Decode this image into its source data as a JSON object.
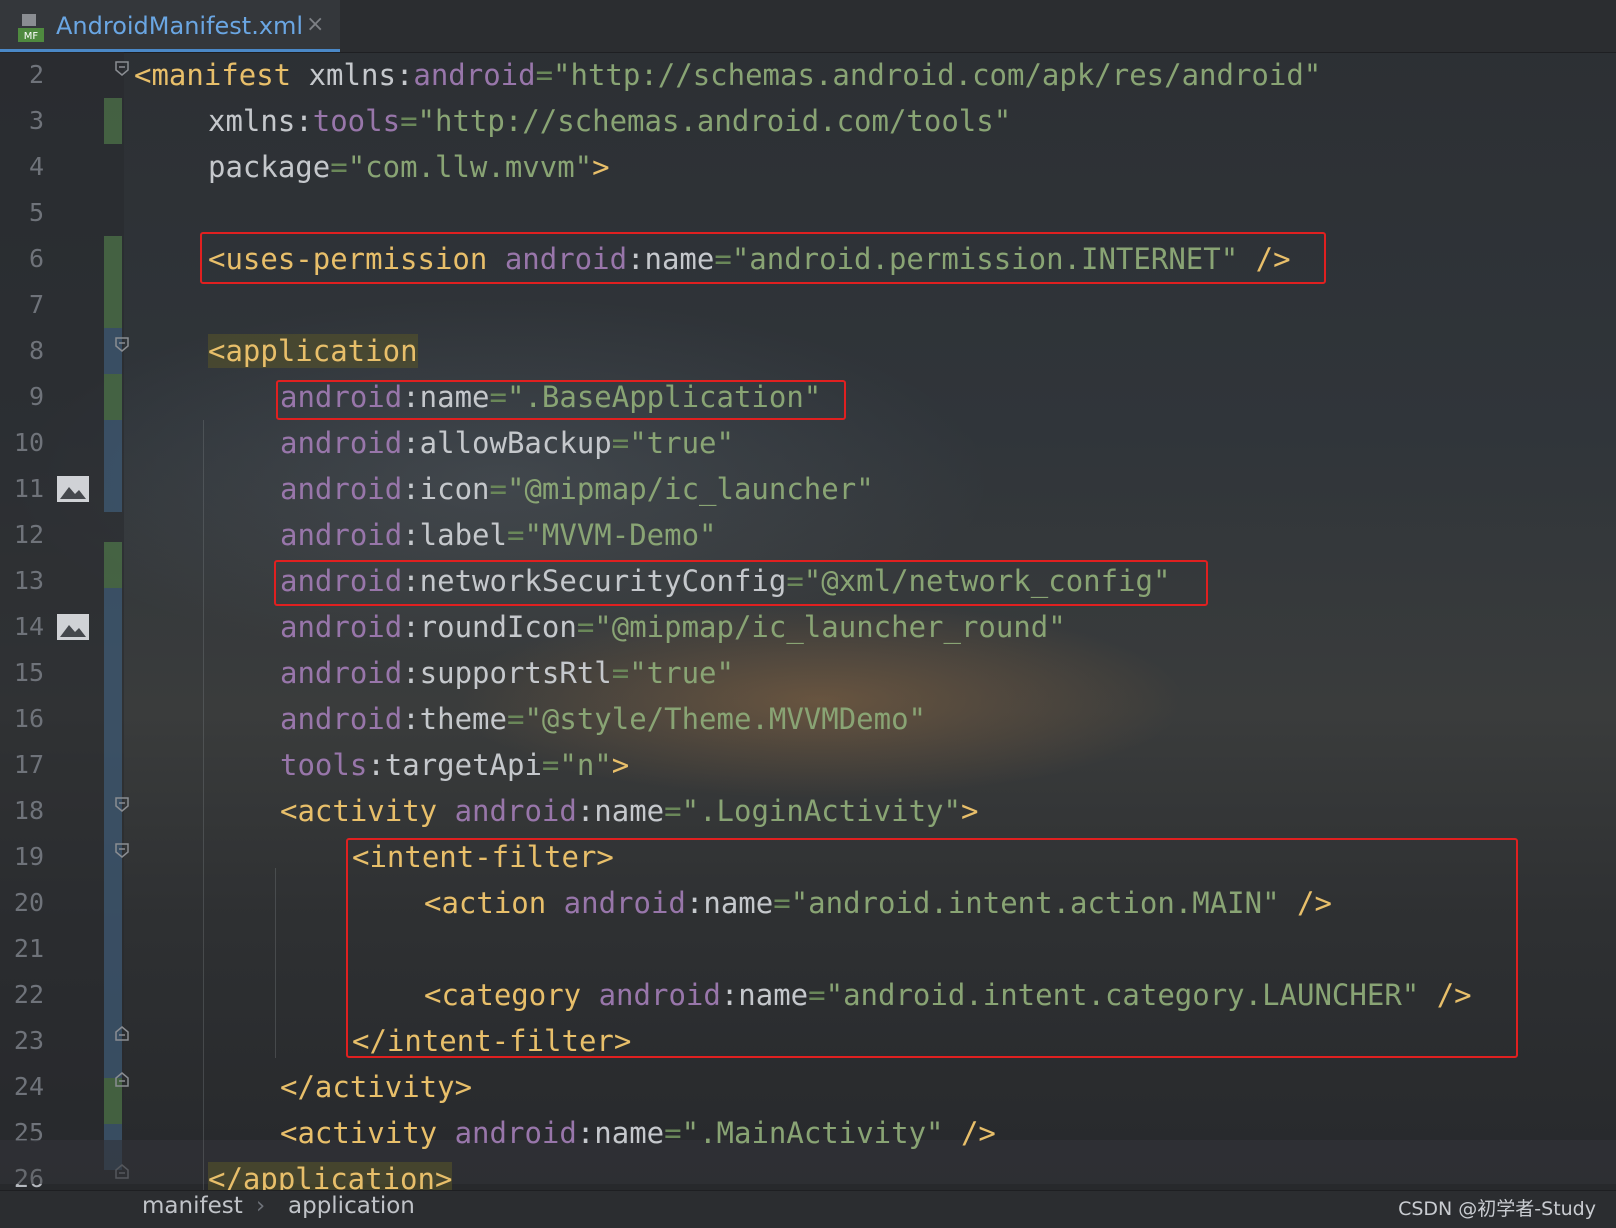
{
  "tab": {
    "title": "AndroidManifest.xml",
    "icon_badge": "MF",
    "close_glyph": "×"
  },
  "line_numbers": [
    "2",
    "3",
    "4",
    "5",
    "6",
    "7",
    "8",
    "9",
    "10",
    "11",
    "12",
    "13",
    "14",
    "15",
    "16",
    "17",
    "18",
    "19",
    "20",
    "21",
    "22",
    "23",
    "24",
    "25",
    "26"
  ],
  "code": {
    "l2": {
      "a": "<manifest",
      "b": " xmlns:",
      "c": "android",
      "d": "=",
      "e": "\"http://schemas.android.com/apk/res/android\""
    },
    "l3": {
      "a": "xmlns:",
      "b": "tools",
      "c": "=",
      "d": "\"http://schemas.android.com/tools\""
    },
    "l4": {
      "a": "package",
      "b": "=",
      "c": "\"com.llw.mvvm\"",
      "d": ">"
    },
    "l6": {
      "a": "<uses-permission",
      "b": " android",
      "c": ":name",
      "d": "=",
      "e": "\"android.permission.INTERNET\"",
      "f": " />"
    },
    "l8": {
      "a": "<",
      "b": "application"
    },
    "l9": {
      "a": "android",
      "b": ":name",
      "c": "=",
      "d": "\".BaseApplication\""
    },
    "l10": {
      "a": "android",
      "b": ":allowBackup",
      "c": "=",
      "d": "\"true\""
    },
    "l11": {
      "a": "android",
      "b": ":icon",
      "c": "=",
      "d": "\"@mipmap/ic_launcher\""
    },
    "l12": {
      "a": "android",
      "b": ":label",
      "c": "=",
      "d": "\"MVVM-Demo\""
    },
    "l13": {
      "a": "android",
      "b": ":networkSecurityConfig",
      "c": "=",
      "d": "\"@xml/network_config\""
    },
    "l14": {
      "a": "android",
      "b": ":roundIcon",
      "c": "=",
      "d": "\"@mipmap/ic_launcher_round\""
    },
    "l15": {
      "a": "android",
      "b": ":supportsRtl",
      "c": "=",
      "d": "\"true\""
    },
    "l16": {
      "a": "android",
      "b": ":theme",
      "c": "=",
      "d": "\"@style/Theme.MVVMDemo\""
    },
    "l17": {
      "a": "tools",
      "b": ":targetApi",
      "c": "=",
      "d": "\"n\"",
      "e": ">"
    },
    "l18": {
      "a": "<activity",
      "b": " android",
      "c": ":name",
      "d": "=",
      "e": "\".LoginActivity\"",
      "f": ">"
    },
    "l19": {
      "a": "<intent-filter>"
    },
    "l20": {
      "a": "<action",
      "b": " android",
      "c": ":name",
      "d": "=",
      "e": "\"android.intent.action.MAIN\"",
      "f": " />"
    },
    "l22": {
      "a": "<category",
      "b": " android",
      "c": ":name",
      "d": "=",
      "e": "\"android.intent.category.LAUNCHER\"",
      "f": " />"
    },
    "l23": {
      "a": "</intent-filter>"
    },
    "l24": {
      "a": "</activity>"
    },
    "l25": {
      "a": "<activity",
      "b": " android",
      "c": ":name",
      "d": "=",
      "e": "\".MainActivity\"",
      "f": " />"
    },
    "l26": {
      "a": "</application>"
    }
  },
  "breadcrumb": {
    "items": [
      "manifest",
      "application"
    ],
    "separator": "›"
  },
  "watermark": "CSDN @初学者-Study",
  "colors": {
    "tag": "#e8bf6a",
    "namespace": "#9876aa",
    "value": "#6a8759",
    "highlight_box": "#e02020",
    "tab_accent": "#4a88c7"
  }
}
